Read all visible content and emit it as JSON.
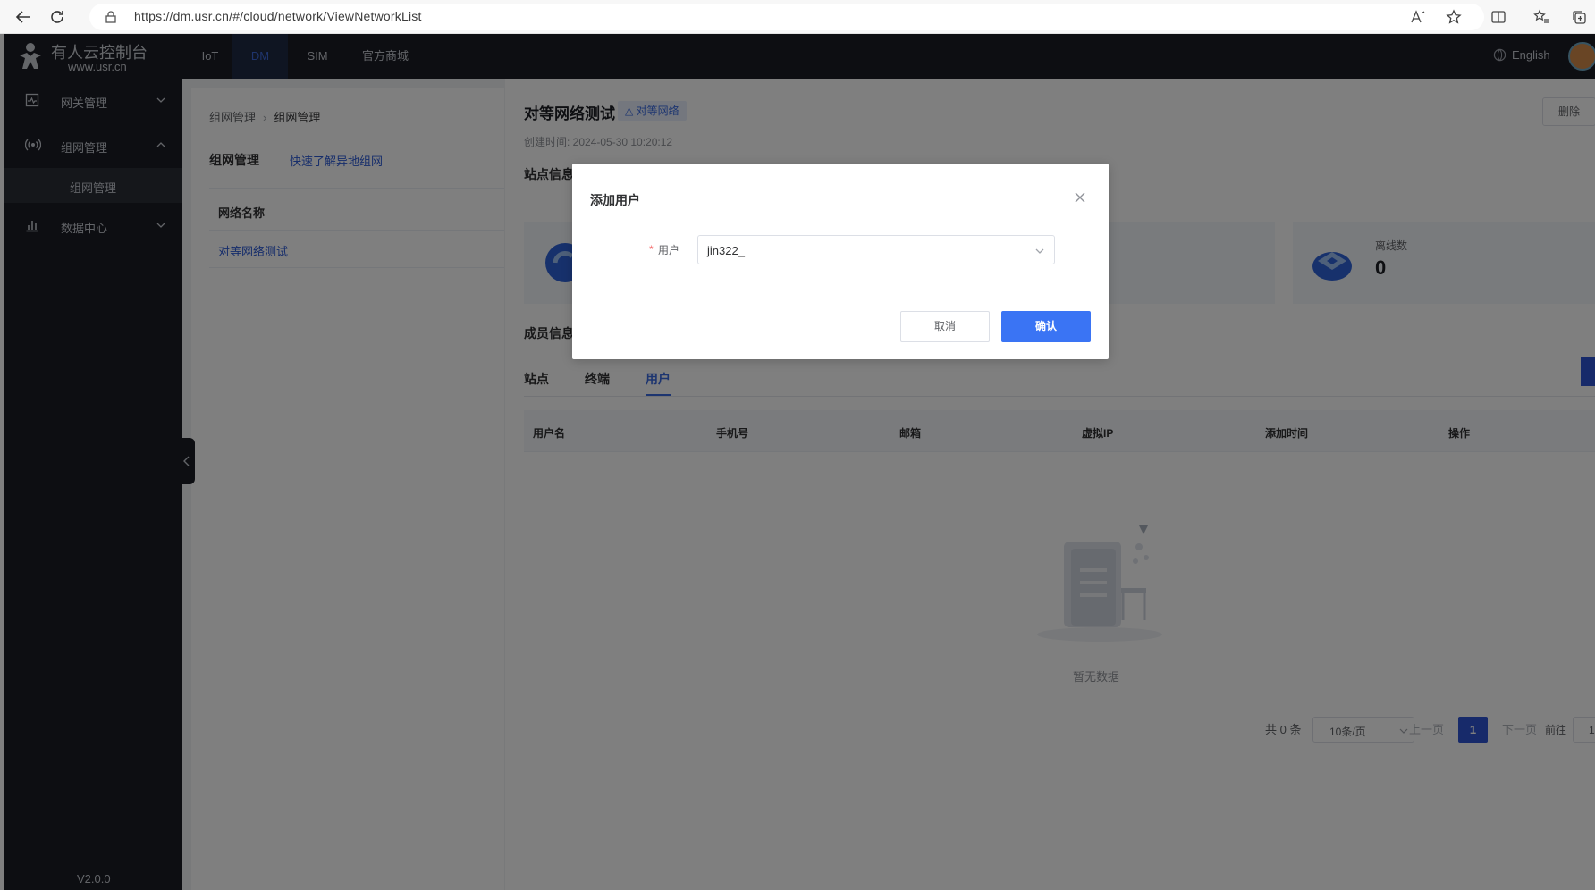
{
  "browser": {
    "url": "https://dm.usr.cn/#/cloud/network/ViewNetworkList"
  },
  "header": {
    "brand_title": "有人云控制台",
    "brand_sub": "www.usr.cn",
    "nav": [
      "IoT",
      "DM",
      "SIM",
      "官方商城"
    ],
    "active_nav": "DM",
    "language": "English"
  },
  "sidebar": {
    "items": [
      {
        "label": "网关管理",
        "icon": "gateway-icon",
        "expanded": false
      },
      {
        "label": "组网管理",
        "icon": "network-signal-icon",
        "expanded": true
      },
      {
        "label": "数据中心",
        "icon": "bar-chart-icon",
        "expanded": false
      }
    ],
    "active_sub": "组网管理",
    "version": "V2.0.0"
  },
  "list_panel": {
    "breadcrumb": [
      "组网管理",
      "组网管理"
    ],
    "title": "组网管理",
    "help_link": "快速了解异地组网",
    "column": "网络名称",
    "rows": [
      "对等网络测试"
    ]
  },
  "detail": {
    "title": "对等网络测试",
    "tag": "△ 对等网络",
    "delete_label": "删除",
    "created": "创建时间: 2024-05-30 10:20:12",
    "site_section": "站点信息",
    "member_section": "成员信息",
    "stat_offline_label": "离线数",
    "stat_offline_value": "0",
    "tabs": [
      "站点",
      "终端",
      "用户"
    ],
    "active_tab": "用户",
    "columns": [
      "用户名",
      "手机号",
      "邮箱",
      "虚拟IP",
      "添加时间",
      "操作"
    ],
    "empty_text": "暂无数据",
    "pagination": {
      "total": "共 0 条",
      "page_size": "10条/页",
      "prev": "上一页",
      "current": "1",
      "next": "下一页",
      "goto_label": "前往",
      "goto_value": "1"
    }
  },
  "dialog": {
    "title": "添加用户",
    "required_mark": "*",
    "field_label": "用户",
    "field_value": "jin322_",
    "cancel_label": "取消",
    "confirm_label": "确认"
  },
  "colors": {
    "header_bg": "#1b1d24",
    "accent": "#3a74f4",
    "link": "#2d5bd6"
  }
}
